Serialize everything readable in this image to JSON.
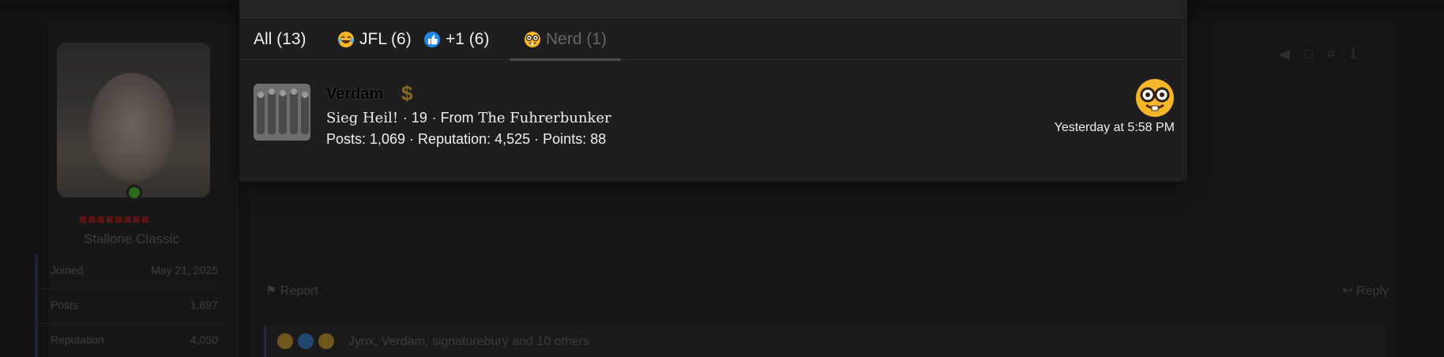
{
  "modal": {
    "title": "",
    "tabs": [
      {
        "label": "All (13)",
        "icon": null,
        "active": false
      },
      {
        "label": "JFL (6)",
        "icon": "jfl-laugh-cry-icon",
        "active": false
      },
      {
        "label": "+1 (6)",
        "icon": "thumbs-up-icon",
        "active": false
      },
      {
        "label": "Nerd (1)",
        "icon": "nerd-face-icon",
        "active": true
      }
    ],
    "reactions": [
      {
        "username": "Verdam",
        "badge": "$",
        "user_title": "Sieg Heil!",
        "age": "19",
        "location_prefix": "From",
        "location": "The Fuhrerbunker",
        "stats": "Posts: 1,069 · Reputation: 4,525 · Points: 88",
        "reaction_icon": "nerd-face-icon",
        "time": "Yesterday at 5:58 PM"
      }
    ]
  },
  "background": {
    "sidebar_username": "■■■■■■■■",
    "sidebar_user_title": "Stallone Classic",
    "stats": [
      {
        "key": "Joined",
        "value": "May 21, 2025"
      },
      {
        "key": "Posts",
        "value": "1,897"
      },
      {
        "key": "Reputation",
        "value": "4,050"
      }
    ],
    "report_label": "Report",
    "reply_label": "Reply",
    "reactions_summary": "Jynx, Verdam, signaturebury and 10 others"
  },
  "colors": {
    "modal_bg": "#1e1e1e",
    "active_tab_underline": "#4a4a4a",
    "badge_gold": "#8a6a20"
  }
}
